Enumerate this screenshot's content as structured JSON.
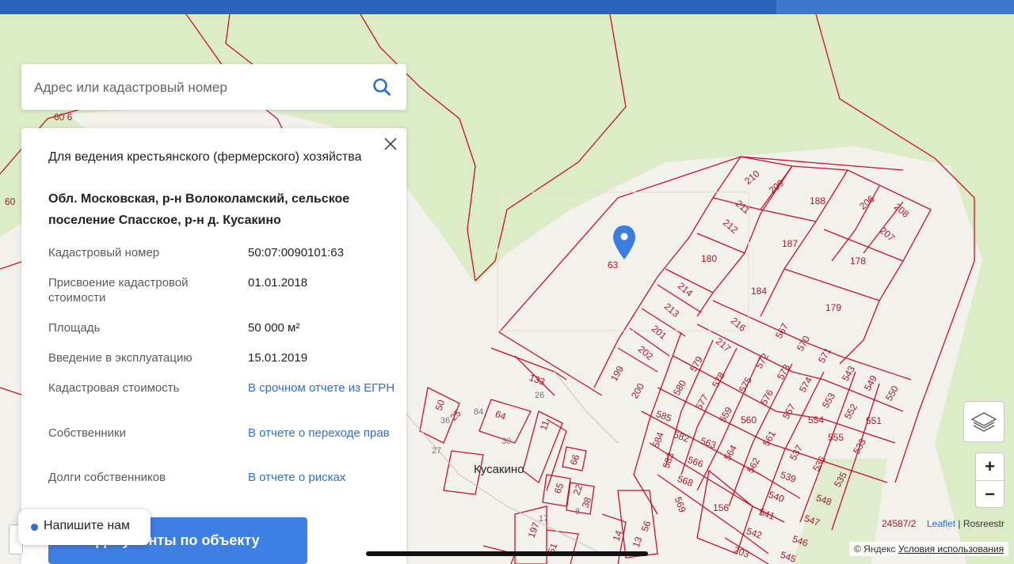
{
  "search": {
    "placeholder": "Адрес или кадастровый номер"
  },
  "object": {
    "purpose": "Для ведения крестьянского (фермерского) хозяйства",
    "address": "Обл. Московская, р-н Волоколамский, сельское поселение Спасское, р-н д. Кусакино",
    "rows": [
      {
        "key": "Кадастровый номер",
        "value": "50:07:0090101:63",
        "link": false
      },
      {
        "key": "Присвоение кадастровой стоимости",
        "value": "01.01.2018",
        "link": false
      },
      {
        "key": "Площадь",
        "value": "50 000 м²",
        "link": false
      },
      {
        "key": "Введение в эксплуатацию",
        "value": "15.01.2019",
        "link": false
      },
      {
        "key": "Кадастровая стоимость",
        "value": "В срочном отчете из ЕГРН",
        "link": true
      },
      {
        "key": "Собственники",
        "value": "В отчете о переходе прав",
        "link": true
      },
      {
        "key": "Долги собственников",
        "value": "В отчете о рисках",
        "link": true
      }
    ],
    "docs_button": "Документы по объекту"
  },
  "chat": {
    "label": "Напишите нам"
  },
  "map": {
    "village": "Кусакино",
    "selected_plot": "63",
    "scale": "24587/2",
    "leaflet": "Leaflet",
    "rosreestr": "| Rosreestr",
    "copyright": "© Яндекс",
    "terms": "Условия использования",
    "plot_labels": [
      "60 6",
      "60",
      "210",
      "209",
      "188",
      "206",
      "208",
      "211",
      "212",
      "187",
      "207",
      "180",
      "178",
      "184",
      "214",
      "179",
      "213",
      "216",
      "567",
      "570",
      "571",
      "201",
      "217",
      "543",
      "549",
      "202",
      "579",
      "572",
      "573",
      "574",
      "550",
      "199",
      "578",
      "200",
      "580",
      "575",
      "576",
      "553",
      "552",
      "551",
      "577",
      "557",
      "554",
      "585",
      "559",
      "560",
      "561",
      "555",
      "533",
      "582",
      "563",
      "584",
      "564",
      "537",
      "536",
      "583",
      "566",
      "562",
      "539",
      "535",
      "568",
      "540",
      "548",
      "569",
      "156",
      "541",
      "547",
      "542",
      "546",
      "133",
      "545",
      "64",
      "203",
      "50",
      "25",
      "11",
      "66",
      "65",
      "22",
      "38",
      "56",
      "197",
      "13",
      "14",
      "51"
    ],
    "house_numbers": [
      "36",
      "84",
      "26",
      "30",
      "27",
      "17",
      "8"
    ]
  },
  "colors": {
    "accent": "#2d6fd4",
    "button": "#3e7fe3",
    "plot_line": "#c8102e",
    "topbar": "#2b64b8",
    "forest": "#dbecc6"
  }
}
